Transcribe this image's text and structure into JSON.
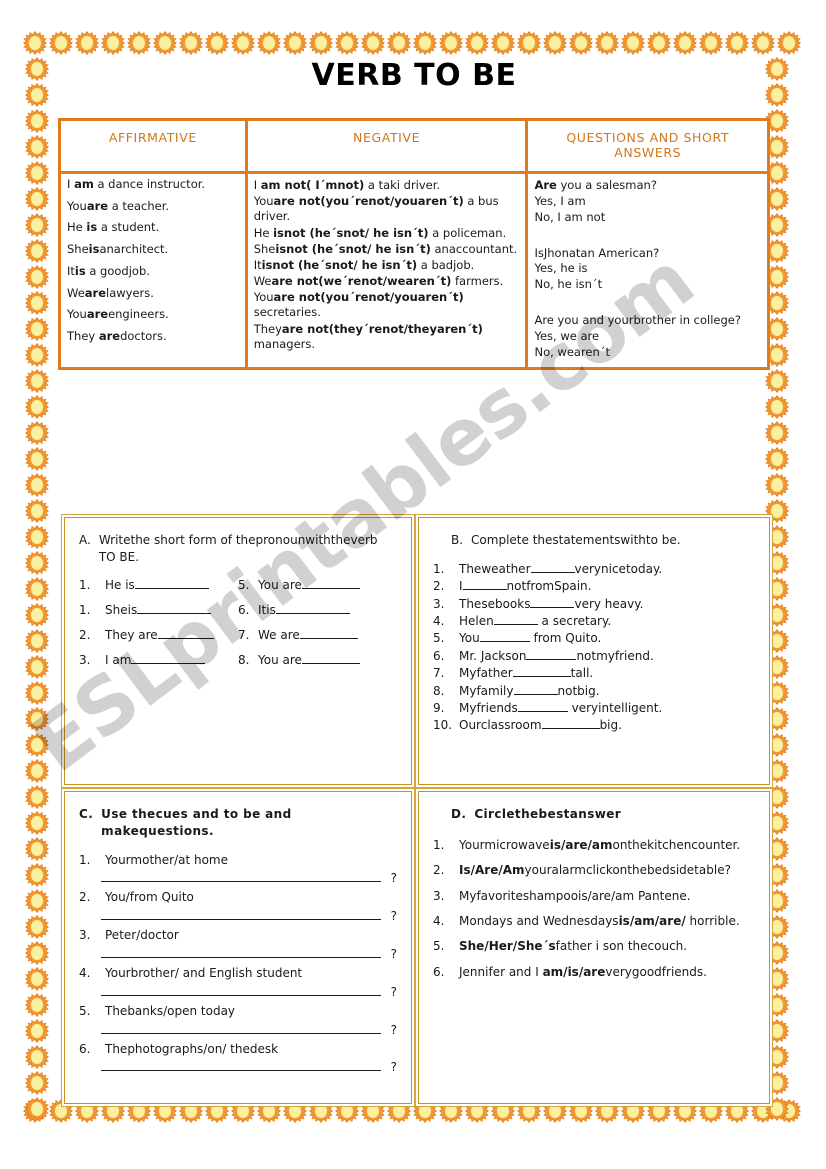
{
  "page": {
    "title": "VERB TO BE",
    "watermark": "ESLprintables.com",
    "colors": {
      "table_border": "#e07b1b",
      "header_text": "#d2761a",
      "box_border": "#d9a43c",
      "sun_ray": "#e8801a",
      "sun_core": "#fbefa0"
    }
  },
  "grammar_table": {
    "headers": {
      "affirmative": "AFFIRMATIVE",
      "negative": "NEGATIVE",
      "questions": "QUESTIONS  AND  SHORT  ANSWERS"
    },
    "affirmative": [
      {
        "pre": "I ",
        "bold": "am",
        "post": " a dance instructor."
      },
      {
        "pre": "You",
        "bold": "are",
        "post": " a teacher."
      },
      {
        "pre": "He ",
        "bold": "is",
        "post": " a student."
      },
      {
        "pre": "She",
        "bold": "is",
        "post": "anarchitect."
      },
      {
        "pre": "It",
        "bold": "is",
        "post": " a goodjob."
      },
      {
        "pre": "We",
        "bold": "are",
        "post": "lawyers."
      },
      {
        "pre": "You",
        "bold": "are",
        "post": "engineers."
      },
      {
        "pre": "They ",
        "bold": "are",
        "post": "doctors."
      }
    ],
    "negative": [
      {
        "pre": "I ",
        "bold": "am not( I´mnot)",
        "post": " a taki driver."
      },
      {
        "pre": "You",
        "bold": "are not(you´renot/youaren´t)",
        "post": " a bus driver."
      },
      {
        "pre": "He ",
        "bold": "isnot (he´snot/ he isn´t)",
        "post": " a policeman."
      },
      {
        "pre": "She",
        "bold": "isnot (he´snot/ he isn´t)",
        "post": " anaccountant."
      },
      {
        "pre": "It",
        "bold": "isnot (he´snot/ he isn´t)",
        "post": " a badjob."
      },
      {
        "pre": "We",
        "bold": "are not(we´renot/wearen´t)",
        "post": " farmers."
      },
      {
        "pre": "You",
        "bold": "are not(you´renot/youaren´t)",
        "post": " secretaries."
      },
      {
        "pre": "They",
        "bold": "are not(they´renot/theyaren´t)",
        "post": " managers."
      }
    ],
    "questions": [
      [
        {
          "pre": "",
          "bold": "Are",
          "post": " you a salesman?"
        },
        {
          "pre": "Yes, I am",
          "bold": "",
          "post": ""
        },
        {
          "pre": "No, I am not",
          "bold": "",
          "post": ""
        }
      ],
      [
        {
          "pre": "IsJhonatan American?",
          "bold": "",
          "post": ""
        },
        {
          "pre": "Yes, he is",
          "bold": "",
          "post": ""
        },
        {
          "pre": "No, he isn´t",
          "bold": "",
          "post": ""
        }
      ],
      [
        {
          "pre": "Are you and yourbrother in college?",
          "bold": "",
          "post": ""
        },
        {
          "pre": "Yes, we are",
          "bold": "",
          "post": ""
        },
        {
          "pre": "No, wearen´t",
          "bold": "",
          "post": ""
        }
      ]
    ]
  },
  "exercise_a": {
    "letter": "A.",
    "instruction": "Writethe short form of thepronounwiththeverb TO BE.",
    "left": [
      {
        "n": "1.",
        "text": "He is",
        "blank_w": 74
      },
      {
        "n": "1.",
        "text": "Sheis",
        "blank_w": 74
      },
      {
        "n": "2.",
        "text": "They are",
        "blank_w": 56
      },
      {
        "n": "3.",
        "text": "I am",
        "blank_w": 74
      }
    ],
    "right": [
      {
        "n": "5.",
        "text": "You are",
        "blank_w": 58
      },
      {
        "n": "6.",
        "text": "Itis",
        "blank_w": 74
      },
      {
        "n": "7.",
        "text": "We are",
        "blank_w": 58
      },
      {
        "n": "8.",
        "text": "You are",
        "blank_w": 58
      }
    ]
  },
  "exercise_b": {
    "letter": "B.",
    "instruction": "Complete thestatementswithto be.",
    "items": [
      {
        "n": "1.",
        "pre": "Theweather",
        "blank_w": 44,
        "post": "verynicetoday."
      },
      {
        "n": "2.",
        "pre": "I",
        "blank_w": 44,
        "post": "notfromSpain."
      },
      {
        "n": "3.",
        "pre": "Thesebooks",
        "blank_w": 44,
        "post": "very heavy."
      },
      {
        "n": "4.",
        "pre": "Helen",
        "blank_w": 44,
        "post": " a secretary."
      },
      {
        "n": "5.",
        "pre": "You",
        "blank_w": 50,
        "post": " from Quito."
      },
      {
        "n": "6.",
        "pre": "Mr. Jackson",
        "blank_w": 50,
        "post": "notmyfriend."
      },
      {
        "n": "7.",
        "pre": "Myfather",
        "blank_w": 58,
        "post": "tall."
      },
      {
        "n": "8.",
        "pre": "Myfamily",
        "blank_w": 44,
        "post": "notbig."
      },
      {
        "n": "9.",
        "pre": "Myfriends",
        "blank_w": 50,
        "post": " veryintelligent."
      },
      {
        "n": "10.",
        "pre": "Ourclassroom",
        "blank_w": 58,
        "post": "big."
      }
    ]
  },
  "exercise_c": {
    "letter": "C.",
    "instruction": "Use thecues and to be and makequestions.",
    "items": [
      {
        "n": "1.",
        "text": "Yourmother/at home",
        "qmark": "?"
      },
      {
        "n": "2.",
        "text": "You/from Quito",
        "qmark": "?"
      },
      {
        "n": "3.",
        "text": "Peter/doctor",
        "qmark": "?"
      },
      {
        "n": "4.",
        "text": "Yourbrother/ and English student",
        "qmark": "?"
      },
      {
        "n": "5.",
        "text": "Thebanks/open today",
        "qmark": "?"
      },
      {
        "n": "6.",
        "text": "Thephotographs/on/ thedesk",
        "qmark": "?"
      }
    ]
  },
  "exercise_d": {
    "letter": "D.",
    "instruction": "Circlethebestanswer",
    "items": [
      {
        "n": "1.",
        "pre": "Yourmicrowave",
        "bold": "is/are/am",
        "post": "onthekitchencounter."
      },
      {
        "n": "2.",
        "pre": "",
        "bold": "Is/Are/Am",
        "post": "youralarmclickonthebedsidetable?"
      },
      {
        "n": "3.",
        "pre": "Myfavoriteshampoo",
        "bold": "",
        "post": "is/are/am Pantene."
      },
      {
        "n": "4.",
        "pre": "Mondays and Wednesdays",
        "bold": "is/am/are/",
        "post": " horrible."
      },
      {
        "n": "5.",
        "pre": "",
        "bold": "She/Her/She´s",
        "post": "father i son thecouch."
      },
      {
        "n": "6.",
        "pre": "Jennifer and I ",
        "bold": "am/is/are",
        "post": "verygoodfriends."
      }
    ]
  }
}
